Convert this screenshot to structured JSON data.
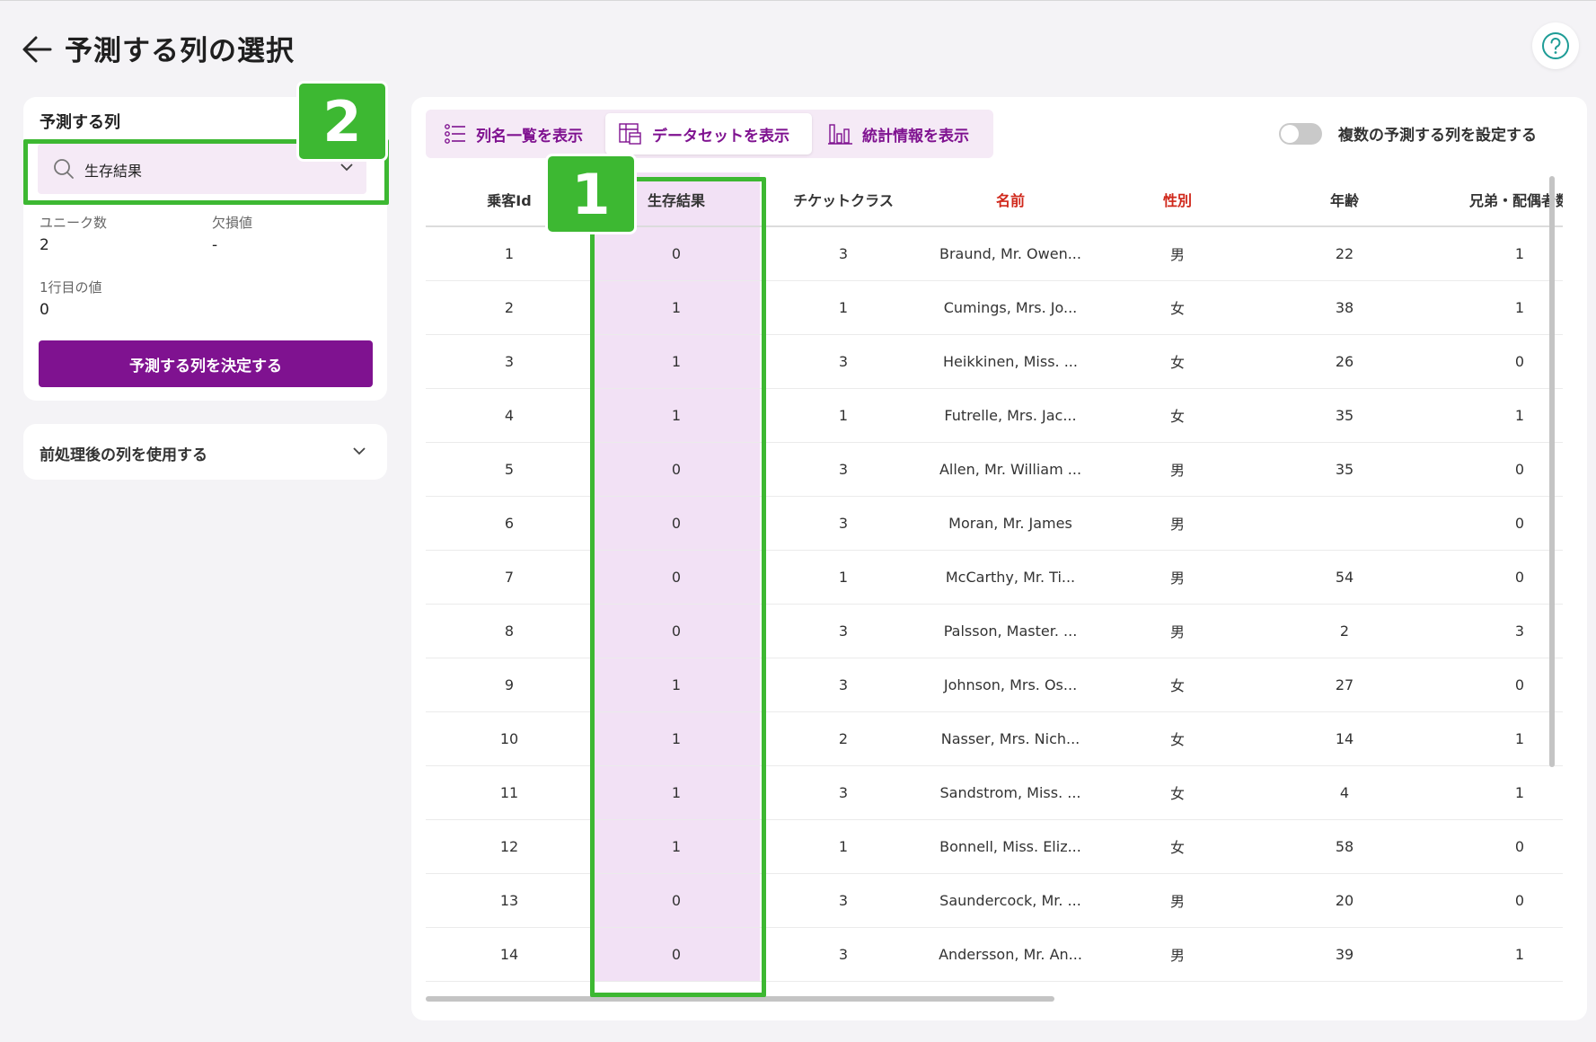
{
  "header": {
    "title": "予測する列の選択"
  },
  "target_panel": {
    "title": "予測する列",
    "select_value": "生存結果",
    "unique_label": "ユニーク数",
    "unique_value": "2",
    "missing_label": "欠損値",
    "missing_value": "-",
    "first_row_label": "1行目の値",
    "first_row_value": "0",
    "decide_button": "予測する列を決定する"
  },
  "preprocess_panel": {
    "label": "前処理後の列を使用する"
  },
  "tabs": [
    {
      "label": "列名一覧を表示"
    },
    {
      "label": "データセットを表示"
    },
    {
      "label": "統計情報を表示"
    }
  ],
  "toggle": {
    "label": "複数の予測する列を設定する"
  },
  "table": {
    "headers": [
      "乗客Id",
      "生存結果",
      "チケットクラス",
      "名前",
      "性別",
      "年齢",
      "兄弟・配偶者数"
    ],
    "rows": [
      [
        "1",
        "0",
        "3",
        "Braund, Mr. Owen...",
        "男",
        "22",
        "1"
      ],
      [
        "2",
        "1",
        "1",
        "Cumings, Mrs. Jo...",
        "女",
        "38",
        "1"
      ],
      [
        "3",
        "1",
        "3",
        "Heikkinen, Miss. ...",
        "女",
        "26",
        "0"
      ],
      [
        "4",
        "1",
        "1",
        "Futrelle, Mrs. Jac...",
        "女",
        "35",
        "1"
      ],
      [
        "5",
        "0",
        "3",
        "Allen, Mr. William ...",
        "男",
        "35",
        "0"
      ],
      [
        "6",
        "0",
        "3",
        "Moran, Mr. James",
        "男",
        "",
        "0"
      ],
      [
        "7",
        "0",
        "1",
        "McCarthy, Mr. Ti...",
        "男",
        "54",
        "0"
      ],
      [
        "8",
        "0",
        "3",
        "Palsson, Master. ...",
        "男",
        "2",
        "3"
      ],
      [
        "9",
        "1",
        "3",
        "Johnson, Mrs. Os...",
        "女",
        "27",
        "0"
      ],
      [
        "10",
        "1",
        "2",
        "Nasser, Mrs. Nich...",
        "女",
        "14",
        "1"
      ],
      [
        "11",
        "1",
        "3",
        "Sandstrom, Miss. ...",
        "女",
        "4",
        "1"
      ],
      [
        "12",
        "1",
        "1",
        "Bonnell, Miss. Eliz...",
        "女",
        "58",
        "0"
      ],
      [
        "13",
        "0",
        "3",
        "Saundercock, Mr. ...",
        "男",
        "20",
        "0"
      ],
      [
        "14",
        "0",
        "3",
        "Andersson, Mr. An...",
        "男",
        "39",
        "1"
      ]
    ]
  },
  "annotations": {
    "badge1": "1",
    "badge2": "2"
  },
  "colors": {
    "accent": "#7f1290",
    "highlight": "#f2e1f5",
    "annotation": "#3db832",
    "required_header": "#d0281b"
  }
}
